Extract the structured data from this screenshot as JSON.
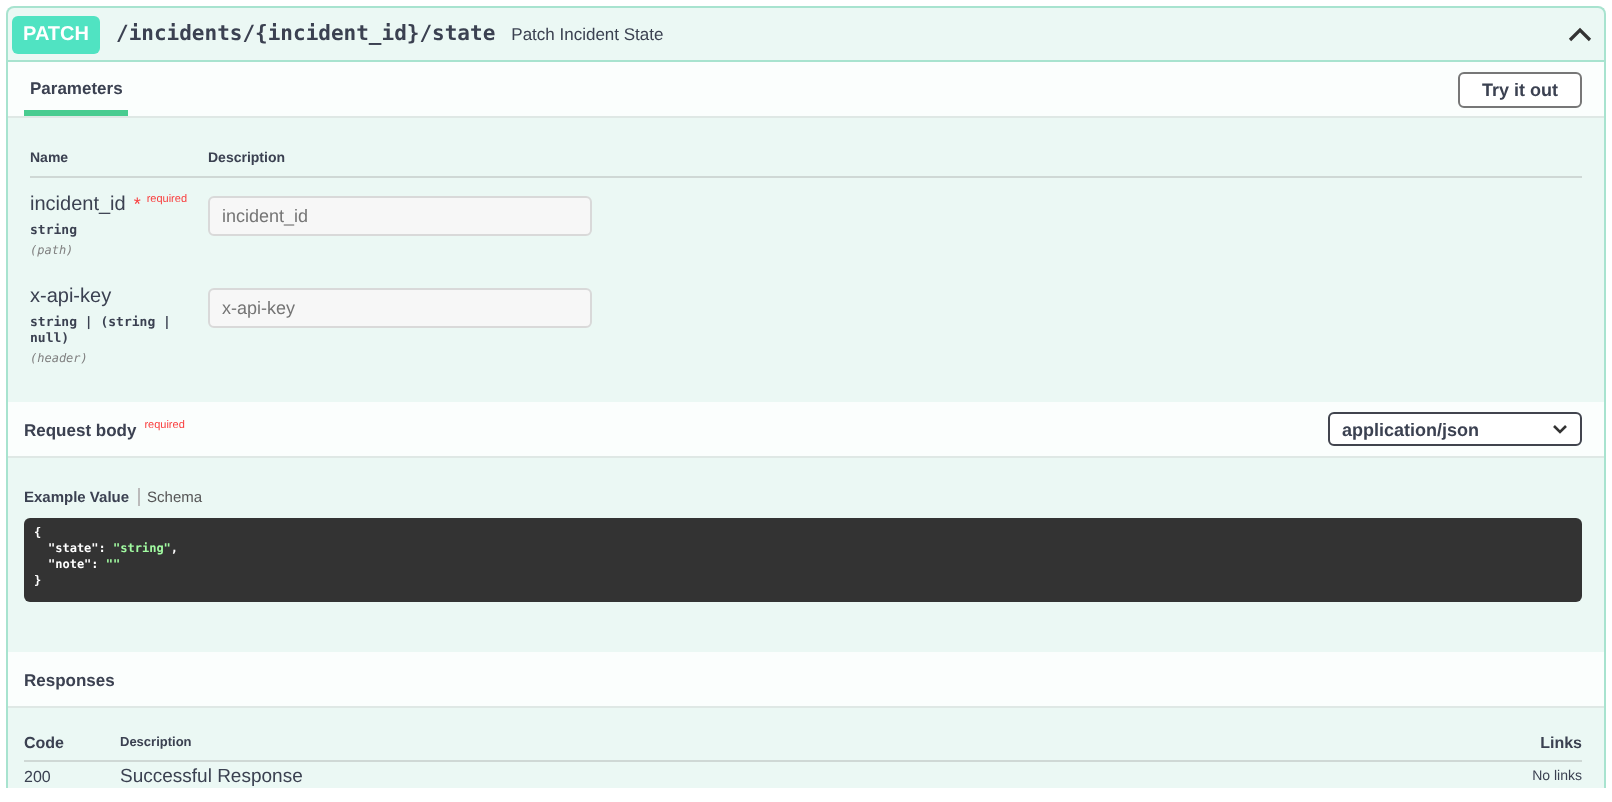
{
  "operation": {
    "method": "PATCH",
    "path": "/incidents/{incident_id}/state",
    "summary": "Patch Incident State",
    "expanded": true
  },
  "parameters_tab": {
    "label": "Parameters",
    "selected": true
  },
  "try_button": "Try it out",
  "param_columns": [
    "Name",
    "Description"
  ],
  "parameters": [
    {
      "name": "incident_id",
      "required_star": "*",
      "required_label": "required",
      "type": "string",
      "location": "(path)",
      "placeholder": "incident_id"
    },
    {
      "name": "x-api-key",
      "type": "string | (string | null)",
      "location": "(header)",
      "placeholder": "x-api-key"
    }
  ],
  "request_body": {
    "title": "Request body",
    "required_label": "required",
    "content_type": "application/json"
  },
  "example_tabs": [
    {
      "label": "Example Value",
      "selected": true
    },
    {
      "label": "Schema",
      "selected": false
    }
  ],
  "example_code": [
    {
      "kind": "punct",
      "text": "{"
    },
    {
      "kind": "pair",
      "key": "\"state\":",
      "value": "\"string\"",
      "tail": ","
    },
    {
      "kind": "pair",
      "key": "\"note\":",
      "value": "\"\""
    },
    {
      "kind": "punct",
      "text": "}"
    }
  ],
  "responses": {
    "title": "Responses",
    "columns": [
      "Code",
      "Description",
      "Links"
    ],
    "rows": [
      {
        "code": "200",
        "description": "Successful Response",
        "links": "No links"
      }
    ]
  }
}
